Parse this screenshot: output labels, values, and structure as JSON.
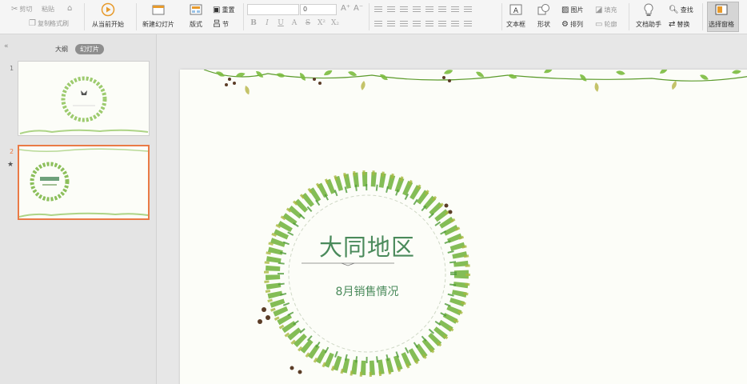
{
  "ribbon": {
    "clipboard": {
      "cut": "剪切",
      "copy": "复制",
      "format_painter": "格式刷",
      "paste": "粘贴"
    },
    "from_current": "从当前开始",
    "new_slide": "新建幻灯片",
    "layout": "版式",
    "reset": "重置",
    "section": "节",
    "font_size_value": "0",
    "text_box": "文本框",
    "shapes": "形状",
    "picture": "图片",
    "fill": "填充",
    "arrange": "排列",
    "outline": "轮廓",
    "doc_assistant": "文档助手",
    "find": "查找",
    "replace": "替换",
    "select_pane": "选择窗格"
  },
  "panel": {
    "tab_outline": "大纲",
    "tab_slides": "幻灯片",
    "slide_numbers": [
      "1",
      "2"
    ]
  },
  "slide": {
    "title": "大同地区",
    "subtitle": "8月销售情况"
  },
  "colors": {
    "accent": "#ea7a46",
    "title_green": "#4a8a5b",
    "leaf_green": "#6fb23a"
  }
}
